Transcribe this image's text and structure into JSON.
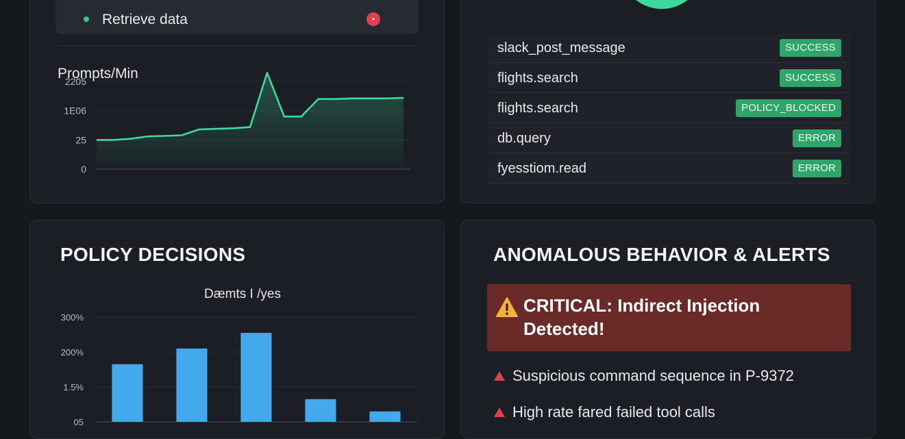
{
  "activity": {
    "retrieve_label": "Retrieve data",
    "alert_glyph": "•",
    "chart_title": "Prompts/Min"
  },
  "tools": {
    "rows": [
      {
        "name": "slack_post_message",
        "status": "SUCCESS"
      },
      {
        "name": "flights.search",
        "status": "SUCCESS"
      },
      {
        "name": "flights.search",
        "status": "POLICY_BLOCKED"
      },
      {
        "name": "db.query",
        "status": "ERROR"
      },
      {
        "name": "fyesstiom.read",
        "status": "ERROR"
      }
    ]
  },
  "policy": {
    "title": "POLICY DECISIONS"
  },
  "alerts": {
    "title": "ANOMALOUS BEHAVIOR & ALERTS",
    "critical_line1": "CRITICAL: Indirect Injection",
    "critical_line2": "Detected!",
    "items": [
      "Suspicious command sequence in P-9372",
      "High rate fared failed tool calls"
    ]
  },
  "colors": {
    "accent_green": "#3ddb9b",
    "bar_blue": "#43a9ea",
    "badge_green": "#2fa56a",
    "critical_red": "#6a2a28",
    "alert_red": "#e0414f",
    "warn_yellow": "#f3b33d"
  },
  "chart_data": [
    {
      "type": "area",
      "title": "Prompts/Min",
      "y_tick_labels": [
        "2205",
        "1E06",
        "25",
        "0"
      ],
      "y_tick_values": [
        150,
        100,
        50,
        0
      ],
      "ylim": [
        0,
        150
      ],
      "grid": true,
      "series": [
        {
          "values": [
            50,
            50,
            52,
            56,
            57,
            58,
            68,
            69,
            70,
            72,
            165,
            90,
            90,
            120,
            120,
            121,
            121,
            121,
            122
          ]
        }
      ]
    },
    {
      "type": "bar",
      "title": "Dæmts I /yes",
      "y_tick_labels": [
        "300%",
        "200%",
        "1.5%",
        "05"
      ],
      "y_tick_values": [
        300,
        200,
        100,
        0
      ],
      "ylim": [
        0,
        300
      ],
      "grid": true,
      "values": [
        165,
        210,
        255,
        65,
        30
      ]
    }
  ]
}
